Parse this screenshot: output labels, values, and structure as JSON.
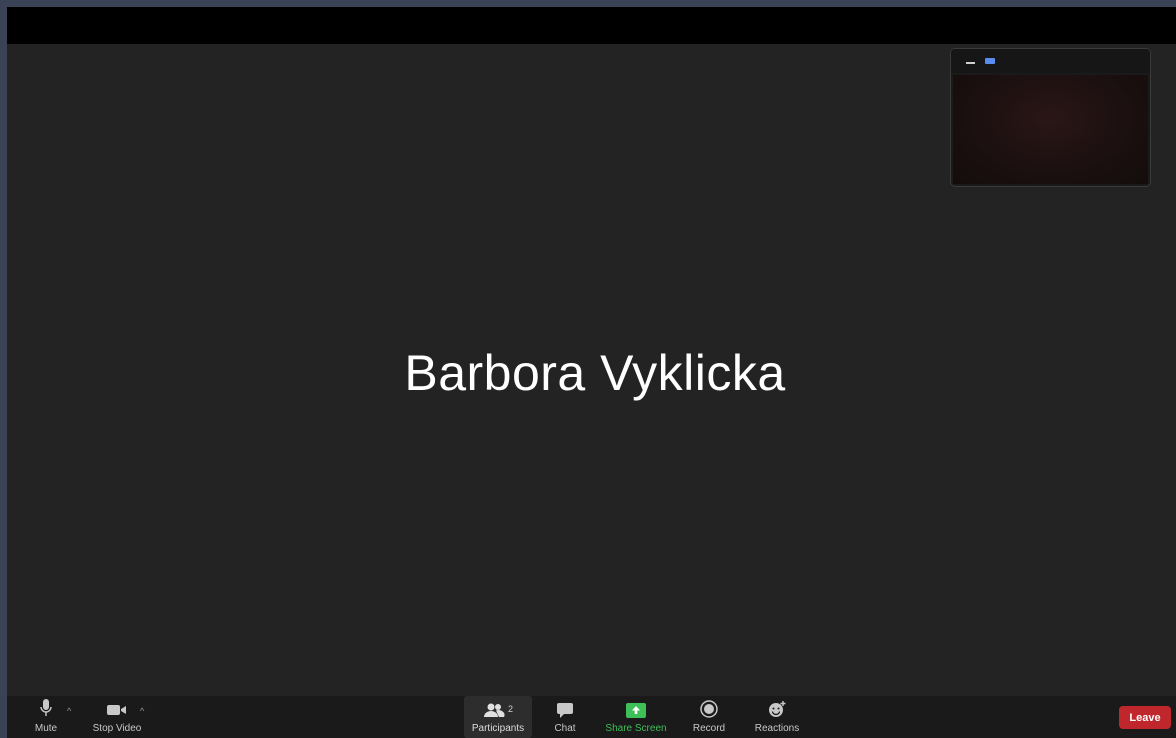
{
  "meeting": {
    "active_speaker_name": "Barbora Vyklicka"
  },
  "toolbar": {
    "mute_label": "Mute",
    "stop_video_label": "Stop Video",
    "participants_label": "Participants",
    "participants_count": "2",
    "chat_label": "Chat",
    "share_screen_label": "Share Screen",
    "record_label": "Record",
    "reactions_label": "Reactions",
    "leave_label": "Leave"
  },
  "icons": {
    "mute": "microphone-icon",
    "video": "video-camera-icon",
    "participants": "people-icon",
    "chat": "chat-bubble-icon",
    "share": "share-arrow-icon",
    "record": "record-icon",
    "reactions": "emoji-plus-icon",
    "caret": "caret-up-icon"
  },
  "colors": {
    "background": "#232323",
    "toolbar": "#1a1a1a",
    "share_accent": "#3fbf58",
    "leave": "#c0272d",
    "view_toggle": "#5a8cf0"
  }
}
